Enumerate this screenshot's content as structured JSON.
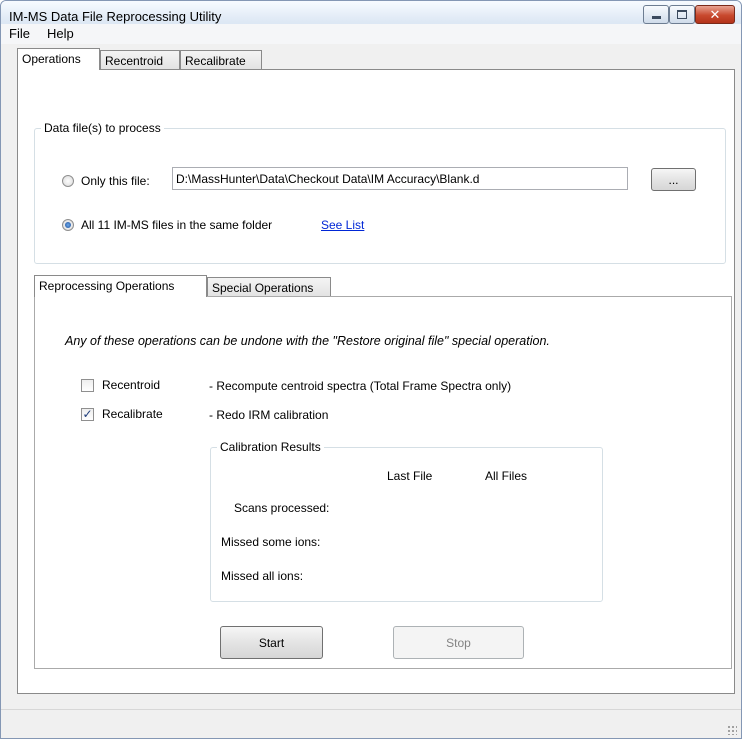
{
  "window": {
    "title": "IM-MS Data File Reprocessing Utility"
  },
  "menu": {
    "file": "File",
    "help": "Help"
  },
  "main_tabs": {
    "operations": "Operations",
    "recentroid": "Recentroid",
    "recalibrate": "Recalibrate"
  },
  "data_files": {
    "legend": "Data file(s) to process",
    "only_this_file_label": "Only this file:",
    "file_path": "D:\\MassHunter\\Data\\Checkout Data\\IM Accuracy\\Blank.d",
    "browse_label": "...",
    "all_files_label": "All 11 IM-MS files in the same folder",
    "see_list": "See List",
    "selected": "all"
  },
  "sub_tabs": {
    "reprocessing": "Reprocessing Operations",
    "special": "Special Operations"
  },
  "reprocessing": {
    "note": "Any of these operations can be undone with the  \"Restore original file\" special operation.",
    "recentroid_label": "Recentroid",
    "recentroid_desc": "- Recompute centroid spectra (Total Frame Spectra only)",
    "recentroid_checked": false,
    "recalibrate_label": "Recalibrate",
    "recalibrate_desc": "- Redo IRM calibration",
    "recalibrate_checked": true
  },
  "calibration_results": {
    "legend": "Calibration Results",
    "col_last_file": "Last File",
    "col_all_files": "All Files",
    "row_scans": "Scans processed:",
    "row_missed_some": "Missed some ions:",
    "row_missed_all": "Missed all ions:"
  },
  "buttons": {
    "start": "Start",
    "stop": "Stop"
  },
  "colors": {
    "link": "#0026d6",
    "close_button": "#c8492e"
  }
}
